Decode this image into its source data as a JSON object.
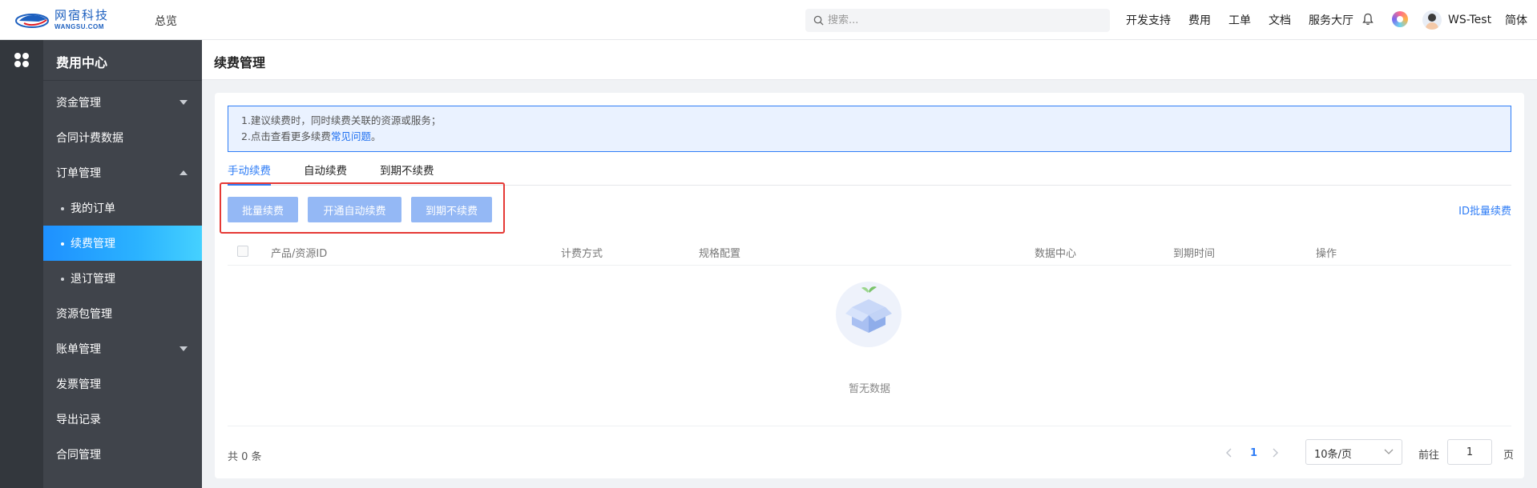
{
  "topbar": {
    "logo": {
      "cn": "网宿科技",
      "en": "WANGSU.COM"
    },
    "overview": "总览",
    "search_placeholder": "搜索...",
    "nav": [
      "开发支持",
      "费用",
      "工单",
      "文档",
      "服务大厅"
    ],
    "user_name": "WS-Test",
    "language": "简体"
  },
  "sidebar": {
    "title": "费用中心",
    "items": [
      {
        "label": "资金管理",
        "caret": "down"
      },
      {
        "label": "合同计费数据"
      },
      {
        "label": "订单管理",
        "caret": "up"
      },
      {
        "label": "我的订单",
        "sub": true
      },
      {
        "label": "续费管理",
        "sub": true,
        "active": true
      },
      {
        "label": "退订管理",
        "sub": true
      },
      {
        "label": "资源包管理"
      },
      {
        "label": "账单管理",
        "caret": "down"
      },
      {
        "label": "发票管理"
      },
      {
        "label": "导出记录"
      },
      {
        "label": "合同管理"
      }
    ]
  },
  "page": {
    "title": "续费管理",
    "notice": {
      "line1": "1.建议续费时，同时续费关联的资源或服务；",
      "line2_prefix": "2.点击查看更多续费",
      "line2_link": "常见问题",
      "line2_suffix": "。"
    },
    "tabs": [
      "手动续费",
      "自动续费",
      "到期不续费"
    ],
    "active_tab": "手动续费",
    "buttons": {
      "batch_renew": "批量续费",
      "enable_auto": "开通自动续费",
      "no_renew": "到期不续费"
    },
    "id_batch_link": "ID批量续费",
    "table_headers": [
      "产品/资源ID",
      "计费方式",
      "规格配置",
      "数据中心",
      "到期时间",
      "操作"
    ],
    "empty_text": "暂无数据",
    "total_text": "共 0 条",
    "current_page": "1",
    "page_size": "10条/页",
    "goto_label": "前往",
    "goto_value": "1",
    "page_unit": "页"
  },
  "colors": {
    "primary": "#2f7df6",
    "sidebar_bg": "#40444b",
    "rail_bg": "#33373d",
    "active_gradient_start": "#1e90ff",
    "active_gradient_end": "#45d1ff",
    "highlight_box": "#e53935",
    "disabled_button": "#94b8f5"
  },
  "icons": {
    "logo": "wangsu-logo-icon",
    "search": "search-icon",
    "bell": "bell-icon",
    "apps": "apps-grid-icon",
    "empty": "empty-box-icon"
  }
}
